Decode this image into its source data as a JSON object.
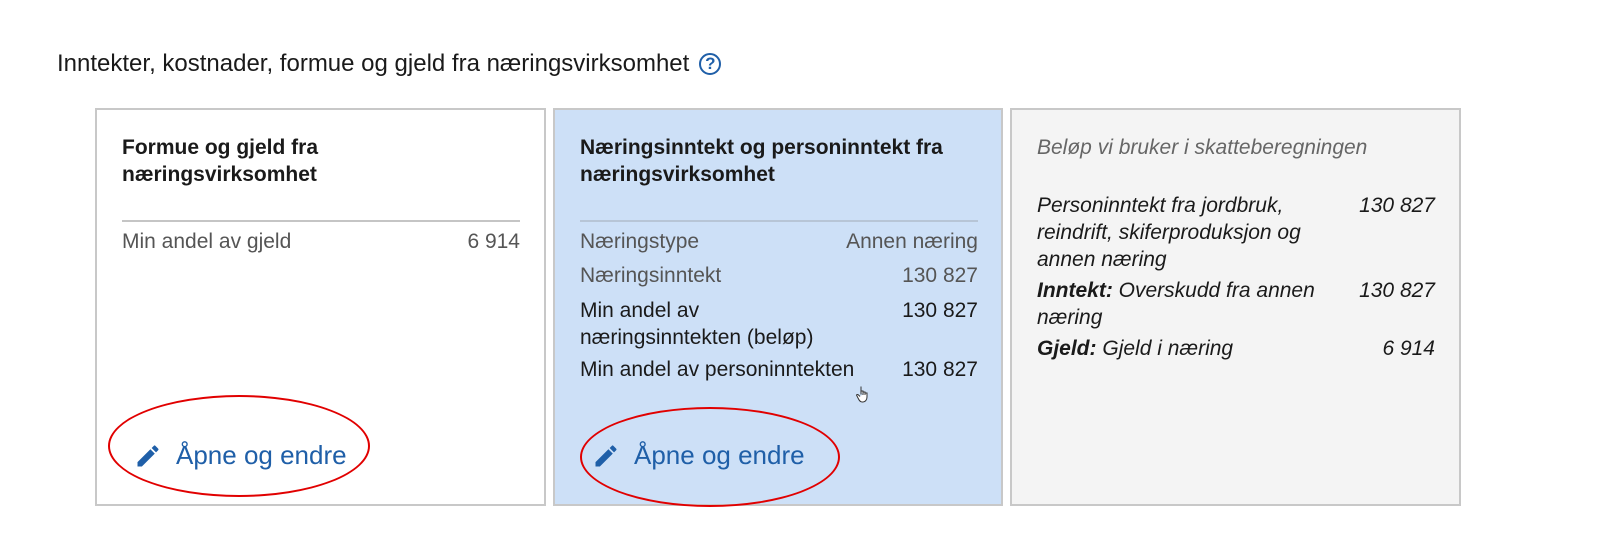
{
  "section": {
    "title": "Inntekter, kostnader, formue og gjeld fra næringsvirksomhet",
    "help_icon_glyph": "?"
  },
  "card_wealth": {
    "title": "Formue og gjeld fra næringsvirksomhet",
    "rows": [
      {
        "label": "Min andel av gjeld",
        "value": "6 914"
      }
    ],
    "edit_label": "Åpne og endre"
  },
  "card_income": {
    "title": "Næringsinntekt og personinntekt fra næringsvirksomhet",
    "rows": [
      {
        "label": "Næringstype",
        "value": "Annen næring"
      },
      {
        "label": "Næringsinntekt",
        "value": "130 827"
      },
      {
        "label": "Min andel av næringsinntekten (beløp)",
        "value": "130 827"
      },
      {
        "label": "Min andel av personinntekten",
        "value": "130 827"
      }
    ],
    "edit_label": "Åpne og endre"
  },
  "card_summary": {
    "title": "Beløp vi bruker i skatteberegningen",
    "rows": [
      {
        "prefix": "",
        "label": "Personinntekt fra jordbruk, reindrift, skiferproduksjon og annen næring",
        "value": "130 827"
      },
      {
        "prefix": "Inntekt:",
        "label": "Overskudd fra annen næring",
        "value": "130 827"
      },
      {
        "prefix": "Gjeld:",
        "label": "Gjeld i næring",
        "value": "6 914"
      }
    ]
  },
  "colors": {
    "accent": "#1f5fa8",
    "highlight_card": "#cde0f7",
    "summary_card": "#f4f4f4",
    "annotation": "#e10000"
  },
  "icons": {
    "help": "question-circle-icon",
    "edit": "pencil-icon",
    "cursor": "hand-pointer-icon"
  }
}
